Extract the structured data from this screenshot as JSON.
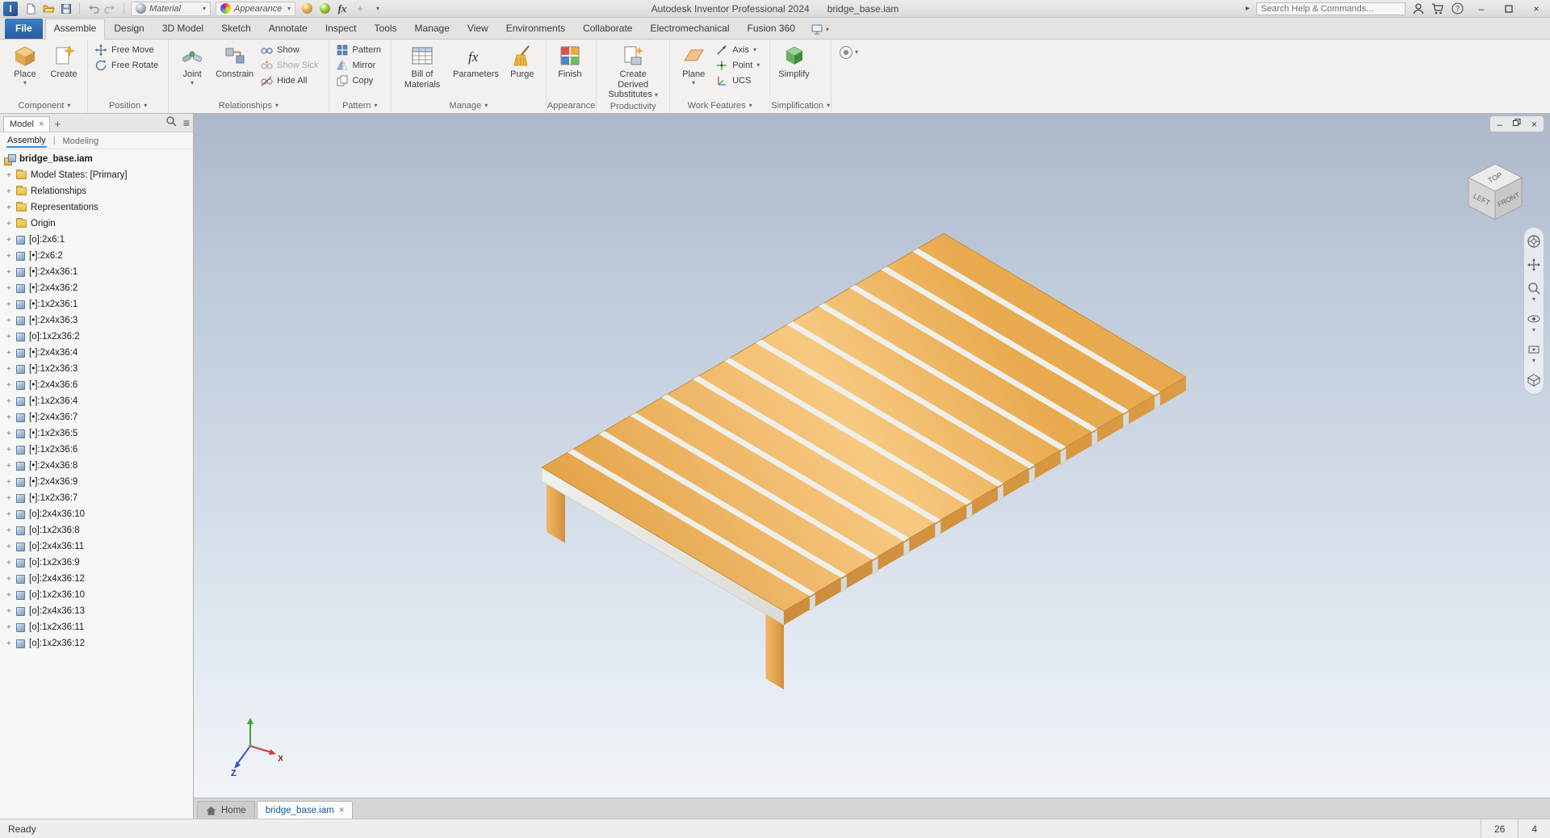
{
  "glyphs": {
    "caret": "▾",
    "close": "×",
    "plus": "+",
    "minus": "–",
    "pipe": "|",
    "tri": "▸",
    "menu": "≡",
    "help": "?"
  },
  "titlebar": {
    "app": "Autodesk Inventor Professional 2024",
    "doc": "bridge_base.iam",
    "material": "Material",
    "appearance": "Appearance",
    "fx": "fx",
    "search_placeholder": "Search Help & Commands..."
  },
  "ribbon_tabs": [
    "File",
    "Assemble",
    "Design",
    "3D Model",
    "Sketch",
    "Annotate",
    "Inspect",
    "Tools",
    "Manage",
    "View",
    "Environments",
    "Collaborate",
    "Electromechanical",
    "Fusion 360"
  ],
  "active_tab": "Assemble",
  "ribbon": {
    "component": {
      "label": "Component",
      "place": "Place",
      "create": "Create"
    },
    "position": {
      "label": "Position",
      "free_move": "Free Move",
      "free_rotate": "Free Rotate"
    },
    "relationships": {
      "label": "Relationships",
      "joint": "Joint",
      "constrain": "Constrain",
      "show": "Show",
      "show_sick": "Show Sick",
      "hide_all": "Hide All"
    },
    "pattern": {
      "label": "Pattern",
      "pattern": "Pattern",
      "mirror": "Mirror",
      "copy": "Copy"
    },
    "manage": {
      "label": "Manage",
      "bom": "Bill of Materials",
      "parameters": "Parameters",
      "purge": "Purge"
    },
    "appearance": {
      "label": "Appearance",
      "finish": "Finish"
    },
    "productivity": {
      "label": "Productivity",
      "create_derived": "Create Derived Substitutes"
    },
    "work_features": {
      "label": "Work Features",
      "plane": "Plane",
      "axis": "Axis",
      "point": "Point",
      "ucs": "UCS"
    },
    "simplification": {
      "label": "Simplification",
      "simplify": "Simplify"
    }
  },
  "browser": {
    "panel_tab": "Model",
    "mode_assembly": "Assembly",
    "mode_modeling": "Modeling",
    "root": "bridge_base.iam",
    "folders": [
      "Model States: [Primary]",
      "Relationships",
      "Representations",
      "Origin"
    ],
    "parts": [
      "[o]:2x6:1",
      "[•]:2x6:2",
      "[•]:2x4x36:1",
      "[•]:2x4x36:2",
      "[•]:1x2x36:1",
      "[•]:2x4x36:3",
      "[o]:1x2x36:2",
      "[•]:2x4x36:4",
      "[•]:1x2x36:3",
      "[•]:2x4x36:6",
      "[•]:1x2x36:4",
      "[•]:2x4x36:7",
      "[•]:1x2x36:5",
      "[•]:1x2x36:6",
      "[•]:2x4x36:8",
      "[•]:2x4x36:9",
      "[•]:1x2x36:7",
      "[o]:2x4x36:10",
      "[o]:1x2x36:8",
      "[o]:2x4x36:11",
      "[o]:1x2x36:9",
      "[o]:2x4x36:12",
      "[o]:1x2x36:10",
      "[o]:2x4x36:13",
      "[o]:1x2x36:11",
      "[o]:1x2x36:12"
    ]
  },
  "viewport": {
    "viewcube": {
      "top": "TOP",
      "left": "LEFT",
      "front": "FRONT"
    },
    "triad": {
      "x": "X",
      "z": "Z"
    },
    "doc_tabs": {
      "home": "Home",
      "active": "bridge_base.iam"
    }
  },
  "statusbar": {
    "status": "Ready",
    "count_occurrences": "26",
    "count_selected": "4"
  }
}
